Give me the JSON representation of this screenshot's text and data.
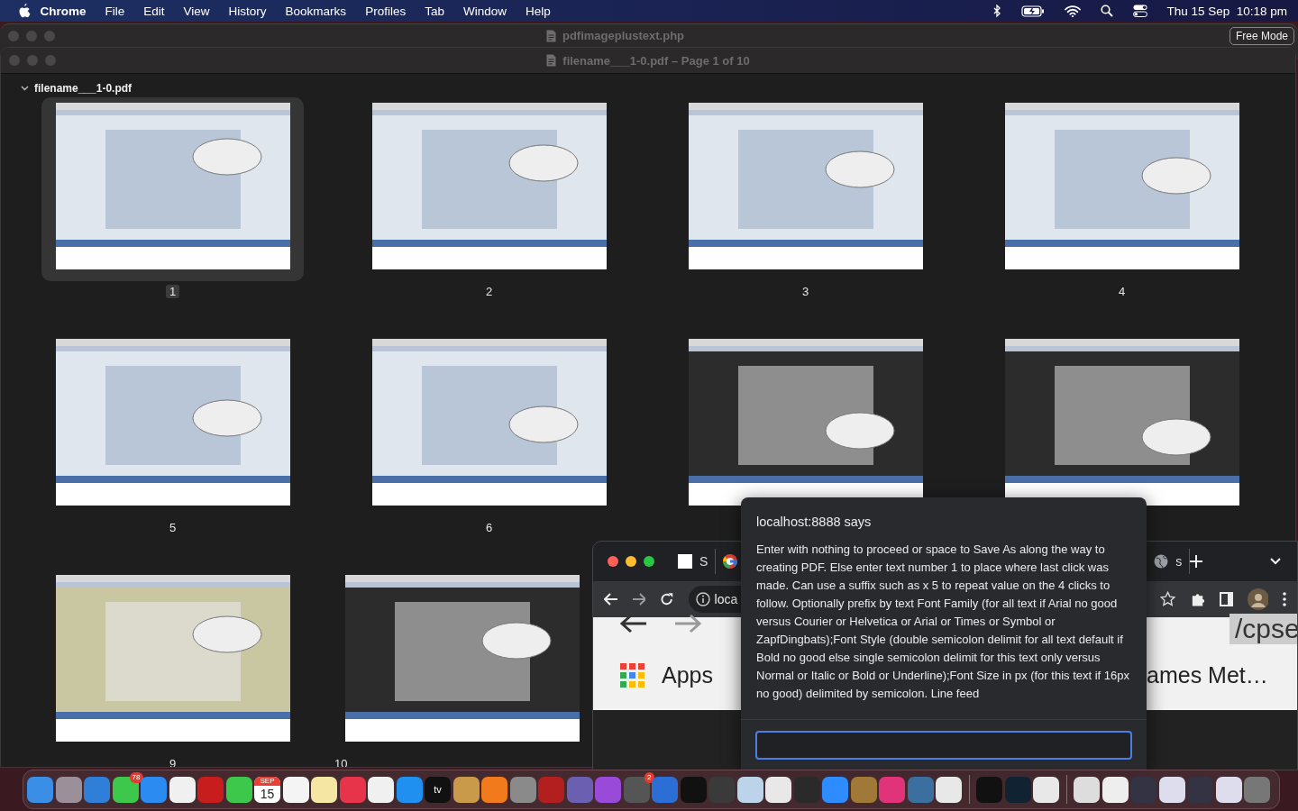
{
  "menu_bar": {
    "app": "Chrome",
    "menus": [
      "File",
      "Edit",
      "View",
      "History",
      "Bookmarks",
      "Profiles",
      "Tab",
      "Window",
      "Help"
    ],
    "datetime": "Thu 15 Sep  10:18 pm"
  },
  "back_window": {
    "title": "pdfimageplustext.php",
    "mode_button": "Free Mode"
  },
  "preview_window": {
    "title": "filename___1-0.pdf – Page 1 of 10",
    "sidebar_header": "filename___1-0.pdf",
    "expanded": true,
    "pages": [
      {
        "label": "1",
        "selected": true,
        "kind": "light"
      },
      {
        "label": "2",
        "selected": false,
        "kind": "light"
      },
      {
        "label": "3",
        "selected": false,
        "kind": "light"
      },
      {
        "label": "4",
        "selected": false,
        "kind": "light"
      },
      {
        "label": "5",
        "selected": false,
        "kind": "light"
      },
      {
        "label": "6",
        "selected": false,
        "kind": "light"
      },
      {
        "selected": false,
        "kind": "dark"
      },
      {
        "selected": false,
        "kind": "dark"
      },
      {
        "label": "9",
        "selected": false,
        "kind": "olive"
      },
      {
        "label": "10",
        "selected": false,
        "kind": "dark"
      }
    ]
  },
  "browser": {
    "tabs": [
      {
        "label": "S",
        "kind": "page"
      },
      {
        "kind": "google"
      },
      {
        "label": "s",
        "kind": "globe"
      }
    ],
    "url": "loca",
    "apps_label": "Apps",
    "bookmark_text": "ames Met…",
    "address_fragment": "/cpse"
  },
  "dialog": {
    "title": "localhost:8888 says",
    "message": "Enter with nothing to proceed or space to Save As along the way to creating PDF.  Else enter text number 1 to place where last click was made.  Can use a suffix such as x 5 to repeat value on the 4 clicks to follow.  Optionally prefix by text Font Family (for all text if Arial no good versus Courier or Helvetica or Arial or Times or Symbol or ZapfDingbats);Font Style (double semicolon delimit for all text default if Bold no good else single semicolon delimit for this text only versus Normal or Italic or Bold or Underline);Font Size in px (for this text if 16px no good) delimited by semicolon.  Line feed",
    "focused": true
  },
  "dock": {
    "messages_badge": "78",
    "calendar_month": "SEP",
    "calendar_day": "15",
    "tv_label": "tv",
    "settings_badge": "2"
  }
}
